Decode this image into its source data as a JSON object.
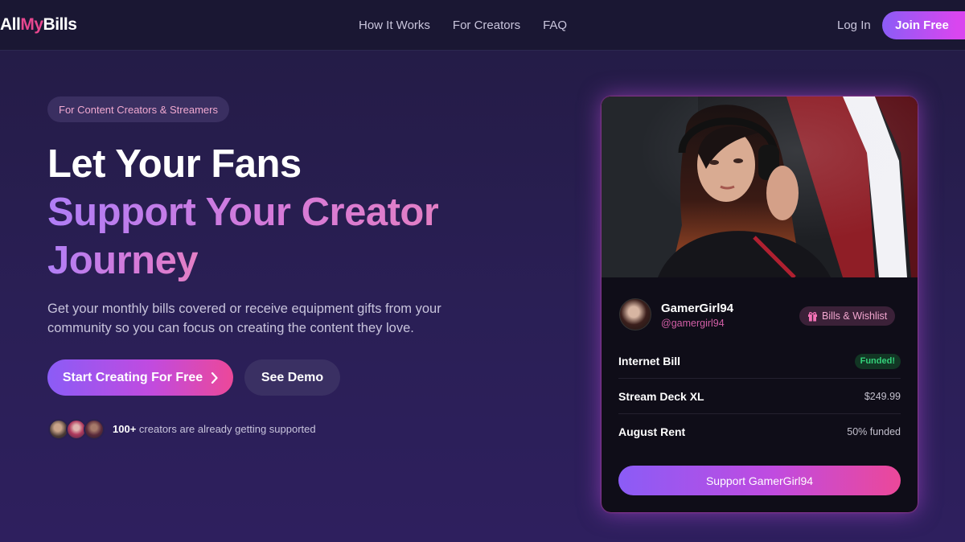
{
  "nav": {
    "logo": {
      "part1": "All",
      "part2": "My",
      "part3": "Bills"
    },
    "links": [
      {
        "label": "How It Works"
      },
      {
        "label": "For Creators"
      },
      {
        "label": "FAQ"
      }
    ],
    "login_label": "Log In",
    "join_label": "Join Free"
  },
  "hero": {
    "tag": "For Content Creators & Streamers",
    "headline_line1": "Let Your Fans",
    "headline_line2": "Support Your Creator",
    "headline_line3": "Journey",
    "description": "Get your monthly bills covered or receive equipment gifts from your community so you can focus on creating the content they love.",
    "cta_primary": "Start Creating For Free",
    "cta_secondary": "See Demo",
    "social_proof_count": "100+",
    "social_proof_text": "creators are already getting supported"
  },
  "card": {
    "name": "GamerGirl94",
    "handle": "@gamergirl94",
    "badge": "Bills & Wishlist",
    "items": [
      {
        "label": "Internet Bill",
        "value": "Funded!"
      },
      {
        "label": "Stream Deck XL",
        "value": "$249.99"
      },
      {
        "label": "August Rent",
        "value": "50% funded"
      }
    ],
    "support_button": "Support GamerGirl94"
  },
  "colors": {
    "accent_purple": "#8b5cf6",
    "accent_pink": "#ec4899",
    "background": "#231b44",
    "funded_green": "#34d17a"
  }
}
